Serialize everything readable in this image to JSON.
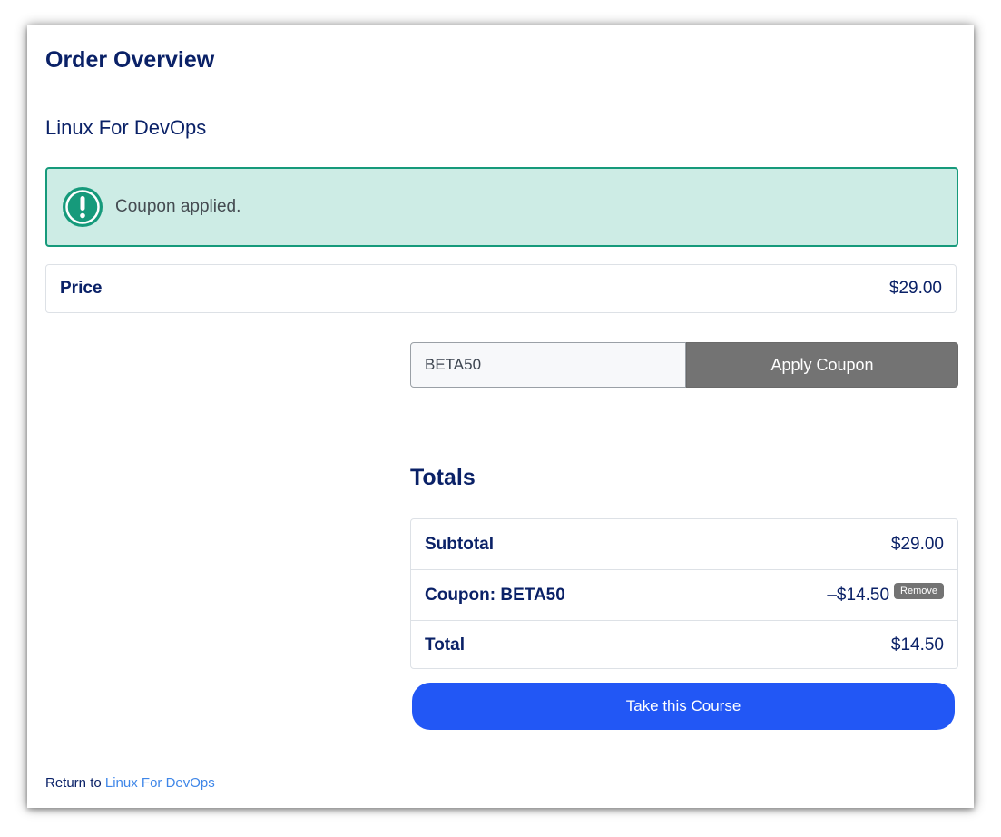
{
  "page": {
    "title": "Order Overview",
    "course_title": "Linux For DevOps"
  },
  "alert": {
    "message": "Coupon applied.",
    "icon": "exclamation-circle-icon",
    "color": "#169a7b"
  },
  "price": {
    "label": "Price",
    "value": "$29.00"
  },
  "coupon": {
    "input_value": "BETA50",
    "apply_label": "Apply Coupon"
  },
  "totals": {
    "heading": "Totals",
    "subtotal_label": "Subtotal",
    "subtotal_value": "$29.00",
    "coupon_label": "Coupon: BETA50",
    "coupon_value": "–$14.50",
    "remove_label": "Remove",
    "total_label": "Total",
    "total_value": "$14.50"
  },
  "cta": {
    "label": "Take this Course",
    "color": "#2257f5"
  },
  "footer": {
    "return_prefix": "Return to",
    "return_link": "Linux For DevOps"
  }
}
